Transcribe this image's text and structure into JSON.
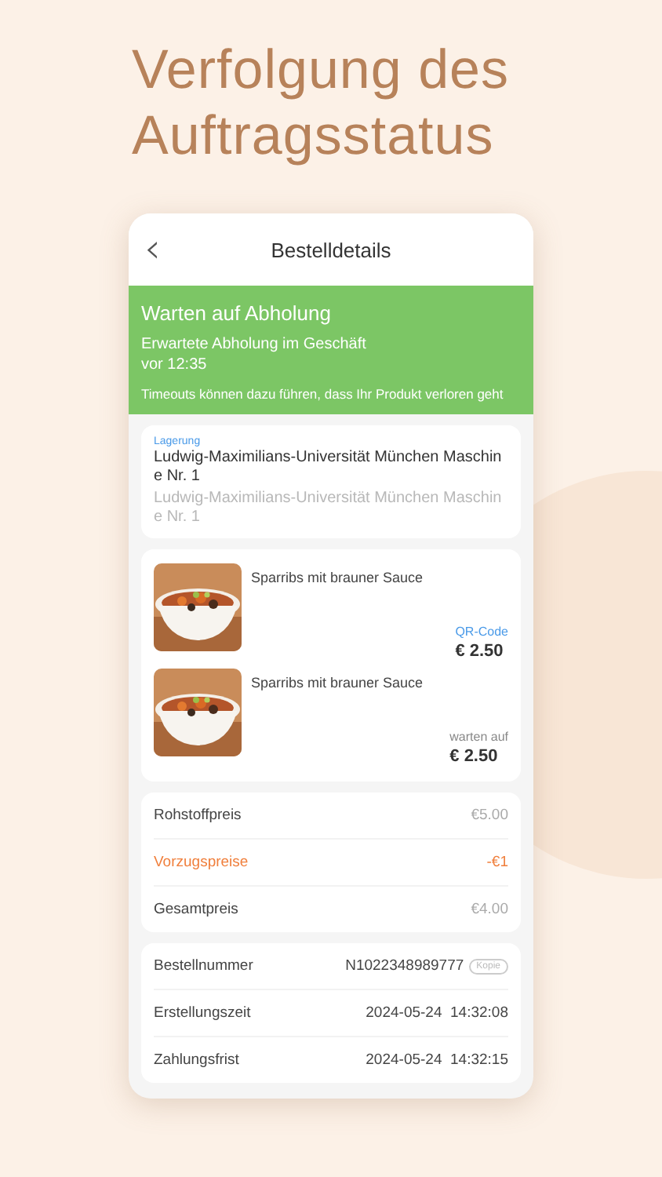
{
  "headline": "Verfolgung des Auftragsstatus",
  "nav": {
    "back": "‹",
    "title": "Bestelldetails"
  },
  "status": {
    "title": "Warten auf Abholung",
    "subtitle": "Erwartete Abholung im Geschäft",
    "time": "vor 12:35",
    "note": "Timeouts können dazu führen, dass Ihr Produkt verloren geht"
  },
  "pickup": {
    "label": "Lagerung",
    "address": "Ludwig-Maximilians-Universität München Maschine Nr. 1",
    "address_secondary": "Ludwig-Maximilians-Universität München Maschine Nr. 1"
  },
  "items": [
    {
      "name": "Sparribs mit brauner Sauce",
      "tag": "QR-Code",
      "kind": "link",
      "price": "€ 2.50"
    },
    {
      "name": "Sparribs mit brauner Sauce",
      "tag": "warten auf",
      "kind": "muted",
      "price": "€ 2.50"
    }
  ],
  "prices": [
    {
      "label": "Rohstoffpreis",
      "value": "€5.00",
      "kind": "normal"
    },
    {
      "label": "Vorzugspreise",
      "value": "-€1",
      "kind": "discount"
    },
    {
      "label": "Gesamtpreis",
      "value": "€4.00",
      "kind": "normal"
    }
  ],
  "order_info": [
    {
      "label": "Bestellnummer",
      "value": "N1022348989777",
      "action": "Kopie"
    },
    {
      "label": "Erstellungszeit",
      "value": "2024-05-24  14:32:08"
    },
    {
      "label": "Zahlungsfrist",
      "value": "2024-05-24  14:32:15"
    }
  ]
}
